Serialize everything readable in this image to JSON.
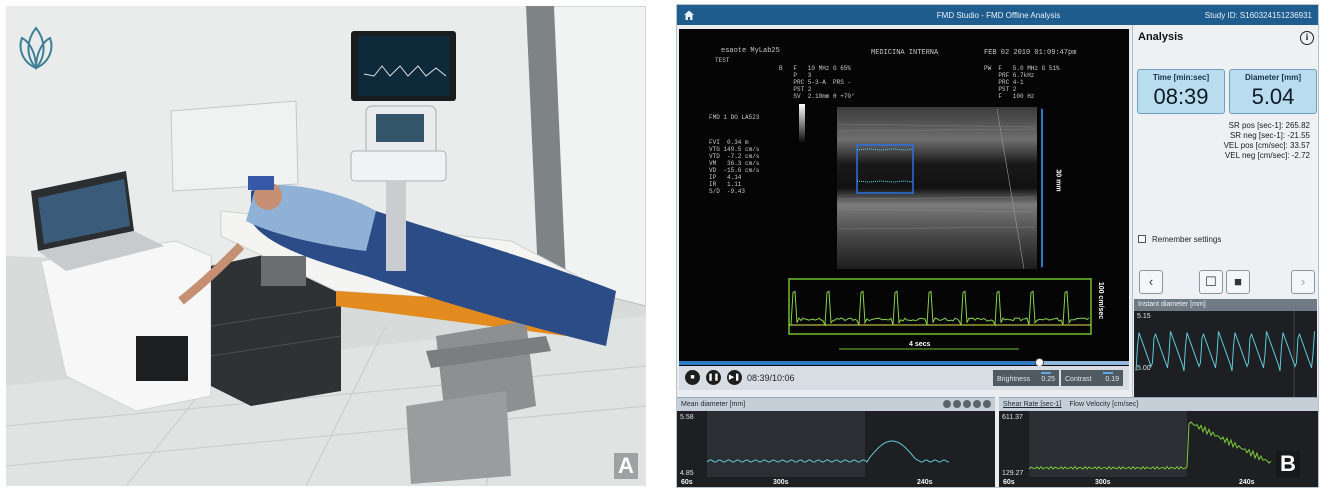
{
  "figure": {
    "panel_a_letter": "A",
    "panel_b_letter": "B"
  },
  "app": {
    "title": "FMD Studio - FMD Offline Analysis",
    "study_id": "Study ID: S160324151236931",
    "home_icon": "home-icon"
  },
  "ultrasound": {
    "header_left": "esaote MyLab25",
    "header_left2": "TEST",
    "header_center": "MEDICINA INTERNA",
    "header_right": "FEB 02 2010 01:09:47pm",
    "b_params": "B   F   10 MHz G 65%\n    P   3\n    PRC 5-3-A  PRS -\n    PST 2\n    SV  2.10mm θ +70°",
    "pw_params": "PW  F   5.0 MHz G 51%\n    PRF 6.7kHz\n    PRC 4-1\n    PST 2\n    F   100 Hz",
    "probe_label": "FMD 1 DO LA523",
    "measurements": "FVI  0.34 m\nVTG 149.5 cm/s\nVTD  -7.2 cm/s\nVM   36.3 cm/s\nVD  -15.6 cm/s\nIP   4.14\nIR   1.11\nS/D  -9.43",
    "depth_label": "30 mm",
    "velocity_label": "100 cm/sec",
    "time_label": "4 secs"
  },
  "playback": {
    "time": "08:39/10:06",
    "progress": 0.8,
    "brightness_label": "Brightness",
    "brightness_value": "0.25",
    "contrast_label": "Contrast",
    "contrast_value": "0.19"
  },
  "analysis": {
    "title": "Analysis",
    "info_icon": "i",
    "time_label": "Time [min:sec]",
    "time_value": "08:39",
    "diameter_label": "Diameter [mm]",
    "diameter_value": "5.04",
    "stats": [
      "SR pos [sec-1]: 265.82",
      "SR neg [sec-1]: -21.55",
      "VEL pos [cm/sec]: 33.57",
      "VEL neg [cm/sec]: -2.72"
    ],
    "remember_label": "Remember settings",
    "buttons": [
      "‹",
      "☐",
      "■",
      "›"
    ]
  },
  "instant_diameter": {
    "title": "Instant diameter [mm]",
    "y_max": "5.15",
    "y_min": "5.00"
  },
  "mean_diameter": {
    "title": "Mean diameter [mm]",
    "y_max": "5.58",
    "y_min": "4.85",
    "x_start": "60s",
    "x_mid": "300s",
    "x_end": "240s"
  },
  "shear_rate": {
    "tab1": "Shear Rate [sec-1]",
    "tab2": "Flow Velocity [cm/sec]",
    "y_max": "611.37",
    "y_min": "129.27",
    "x_start": "60s",
    "x_mid": "300s",
    "x_end": "240s"
  },
  "colors": {
    "title_bar": "#1f5d8f",
    "accent_blue": "#2e7cc4",
    "trace_cyan": "#5fc9d6",
    "trace_green": "#7dc93a",
    "doppler_box": "#6fbe2e"
  }
}
